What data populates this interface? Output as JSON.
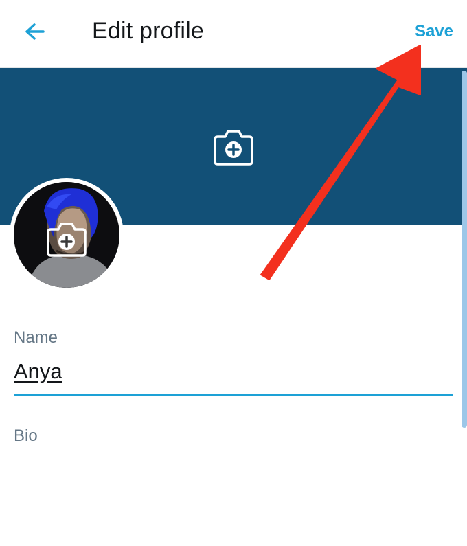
{
  "header": {
    "title": "Edit profile",
    "save_label": "Save",
    "back_icon": "arrow-left-icon"
  },
  "banner": {
    "color": "#125077",
    "camera_icon": "camera-plus-icon"
  },
  "avatar": {
    "camera_icon": "camera-plus-icon"
  },
  "form": {
    "name_label": "Name",
    "name_value": "Anya",
    "bio_label": "Bio"
  },
  "annotation": {
    "type": "red-arrow",
    "color": "#f3301e",
    "points_to": "save-button"
  },
  "colors": {
    "accent": "#1da1d6",
    "label": "#657786"
  }
}
